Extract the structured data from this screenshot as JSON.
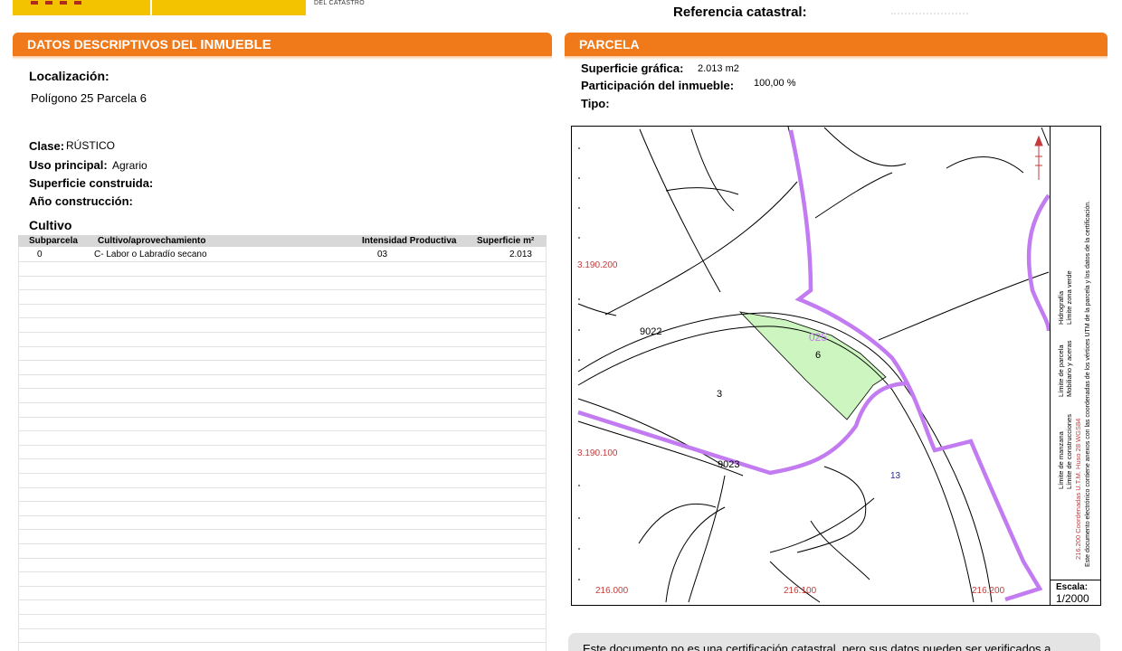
{
  "header": {
    "agency": "DEL CATASTRO",
    "reference_label": "Referencia catastral:"
  },
  "left_panel": {
    "title_prefix": "DATOS DESCRIPTIVOS DEL ",
    "title_bold": "INMUEBLE",
    "localizacion_label": "Localización:",
    "localizacion_value": "Polígono 25 Parcela 6",
    "clase_label": "Clase:",
    "clase_value": "RÚSTICO",
    "uso_label": "Uso principal:",
    "uso_value": "Agrario",
    "sup_construida_label": "Superficie construida:",
    "anio_label": "Año construcción:",
    "cultivo_title": "Cultivo",
    "table": {
      "columns": [
        "Subparcela",
        "Cultivo/aprovechamiento",
        "Intensidad Productiva",
        "Superficie m²"
      ],
      "rows": [
        [
          "0",
          "C- Labor o Labradío secano",
          "03",
          "2.013"
        ]
      ]
    }
  },
  "right_panel": {
    "title": "PARCELA",
    "sup_grafica_label": "Superficie gráfica:",
    "sup_grafica_value": "2.013 m2",
    "participacion_label": "Participación del inmueble:",
    "participacion_value": "100,00 %",
    "tipo_label": "Tipo:"
  },
  "map": {
    "y_ticks": [
      "3.190.200",
      "3.190.100"
    ],
    "x_ticks": [
      "216.000",
      "216.100",
      "216.200"
    ],
    "manzana_label": "025",
    "parcel_labels": [
      "6",
      "3",
      "13",
      "9022",
      "9023"
    ],
    "legend_items": [
      "Hidrografía",
      "Límite zona verde",
      "Límite de parcela",
      "Mobiliario y aceras",
      "Límite de manzana",
      "Límite de construcciones"
    ],
    "coords_note": "216.200 Coordenadas U.T.M. Huso 28 WGS84",
    "legal_note": "Este documento electrónico contiene anexos con las coordenadas de los vértices UTM de la parcela y los datos de la certificación.",
    "scale_label": "Escala:",
    "scale_value": "1/2000",
    "colors": {
      "manzana": "#c27bf0",
      "selected_parcel": "#ccf5c0",
      "coords": "#c43c3c"
    }
  },
  "footer": {
    "note": "Este documento no es una certificación catastral, pero sus datos pueden ser verificados a"
  }
}
